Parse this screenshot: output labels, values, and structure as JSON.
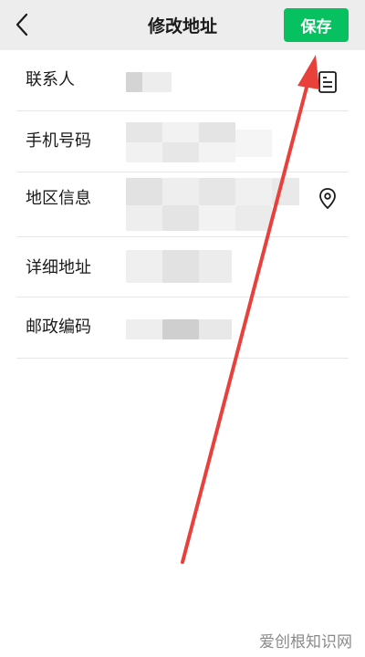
{
  "header": {
    "title": "修改地址",
    "save_label": "保存",
    "back_icon": "chevron-left-icon"
  },
  "form": {
    "rows": [
      {
        "label": "联系人",
        "value": "",
        "icon": "contact-card-icon"
      },
      {
        "label": "手机号码",
        "value": ""
      },
      {
        "label": "地区信息",
        "value": "",
        "icon": "location-pin-icon"
      },
      {
        "label": "详细地址",
        "value": ""
      },
      {
        "label": "邮政编码",
        "value": ""
      }
    ]
  },
  "watermark": "爱创根知识网",
  "colors": {
    "accent": "#07c160",
    "arrow": "#e8413b",
    "header_bg": "#ededed"
  }
}
